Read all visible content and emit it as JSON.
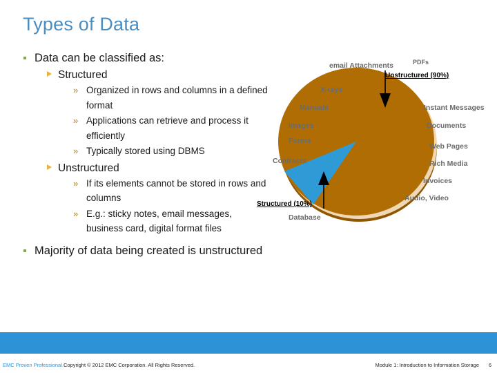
{
  "slide": {
    "title": "Types of Data"
  },
  "body": {
    "bullet1": {
      "text": "Data can be classified as:",
      "sub": [
        {
          "text": "Structured",
          "items": [
            "Organized in rows and columns in a defined format",
            "Applications can retrieve and process it efficiently",
            "Typically stored using DBMS"
          ]
        },
        {
          "text": "Unstructured",
          "items": [
            "If its elements cannot be stored in rows and columns",
            "E.g.: sticky notes, email messages, business card, digital format files"
          ]
        }
      ]
    },
    "bullet2": {
      "text": "Majority of data being created is unstructured"
    },
    "markers": {
      "level3": "»"
    }
  },
  "chart_data": {
    "type": "pie",
    "title": "",
    "categories": [
      "Unstructured",
      "Structured"
    ],
    "values": [
      90,
      10
    ],
    "value_labels": [
      "90%",
      "10%"
    ],
    "colors": [
      "#b06d03",
      "#2e9bd6"
    ],
    "callouts": [
      {
        "label": "Unstructured  (90%)"
      },
      {
        "label": "Structured  (10%)"
      }
    ],
    "annotations_left": [
      "email Attachments",
      "PDFs",
      "X-rays",
      "Manuals",
      "Images",
      "Forms",
      "Contracts",
      "Database"
    ],
    "annotations_right": [
      "Instant Messages",
      "Documents",
      "Web Pages",
      "Rich Media",
      "Invoices",
      "Audio, Video"
    ],
    "legend": "none",
    "grid": false
  },
  "pie_labels": {
    "email_attachments": "email Attachments",
    "pdfs": "PDFs",
    "xrays": "X-rays",
    "manuals": "Manuals",
    "images": "Images",
    "forms": "Forms",
    "contracts": "Contracts",
    "database": "Database",
    "instant_messages": "Instant Messages",
    "documents": "Documents",
    "web_pages": "Web Pages",
    "rich_media": "Rich Media",
    "invoices": "Invoices",
    "audio_video": "Audio, Video",
    "callout_unstructured": "Unstructured  (90%)",
    "callout_structured": "Structured  (10%)"
  },
  "footer": {
    "brand": "EMC Proven Professional.",
    "copyright": "Copyright © 2012 EMC Corporation. All Rights Reserved.",
    "module": "Module 1: Introduction to Information Storage",
    "page": "6"
  },
  "colors": {
    "title_blue": "#4a8dc0",
    "band_blue": "#2e92d6",
    "pie_orange": "#b06d03",
    "pie_blue": "#2e9bd6",
    "bullet_green": "#84a94b",
    "bullet_gold": "#e8b33c"
  }
}
